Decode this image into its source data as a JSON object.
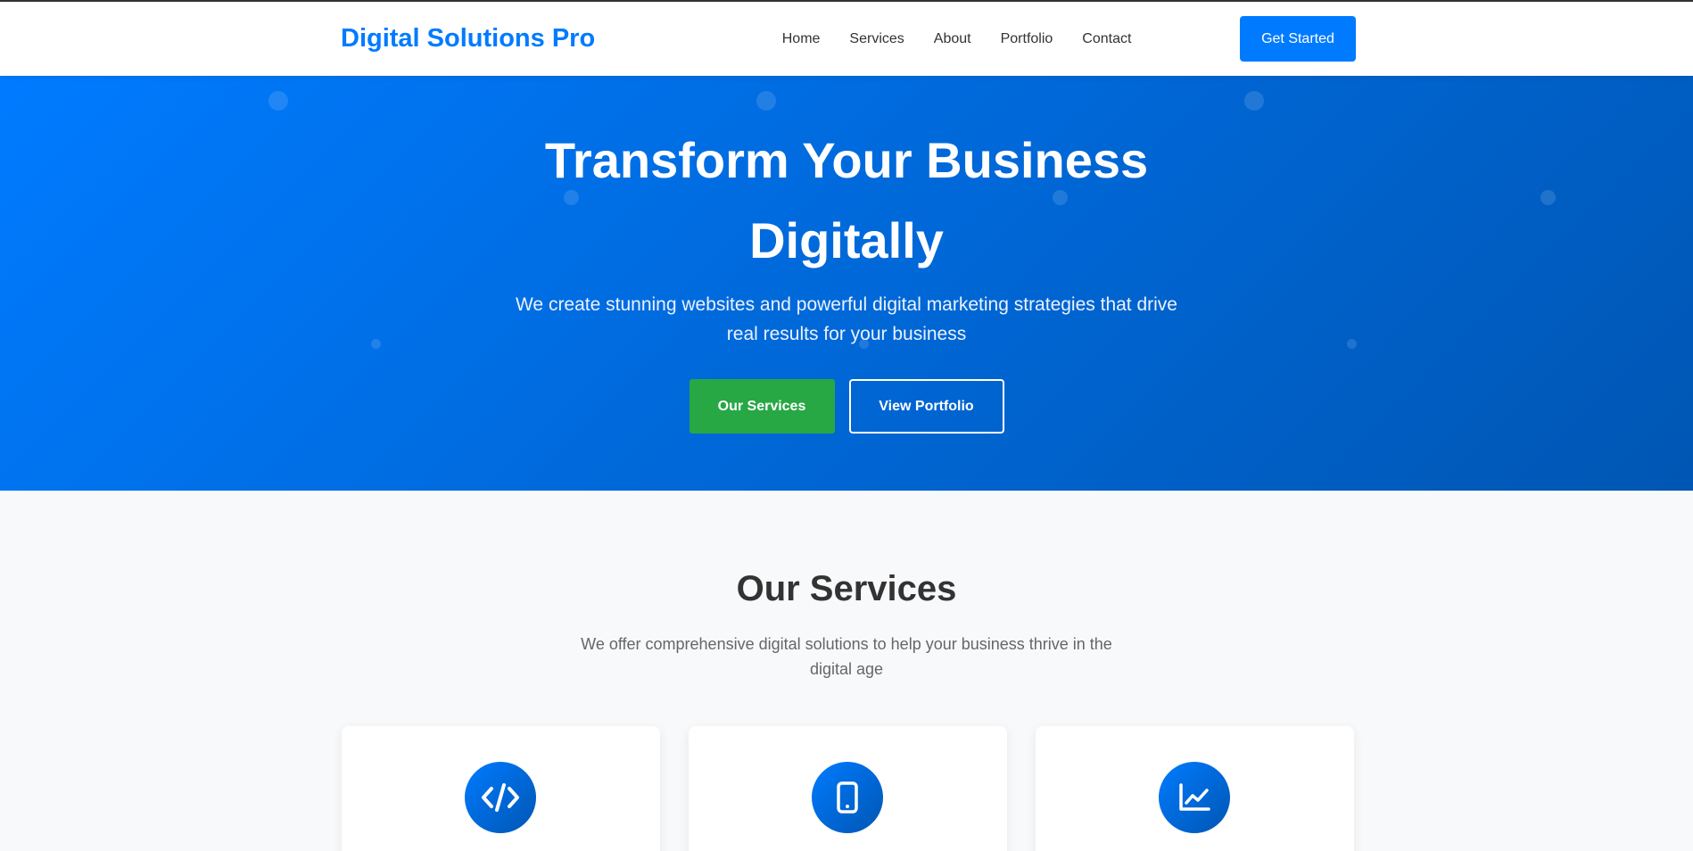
{
  "header": {
    "brand": "Digital Solutions Pro",
    "nav": [
      {
        "label": "Home"
      },
      {
        "label": "Services"
      },
      {
        "label": "About"
      },
      {
        "label": "Portfolio"
      },
      {
        "label": "Contact"
      }
    ],
    "cta_label": "Get Started"
  },
  "hero": {
    "title": "Transform Your Business Digitally",
    "subtitle": "We create stunning websites and powerful digital marketing strategies that drive real results for your business",
    "primary_button": "Our Services",
    "secondary_button": "View Portfolio"
  },
  "services": {
    "title": "Our Services",
    "subtitle": "We offer comprehensive digital solutions to help your business thrive in the digital age",
    "cards": [
      {
        "icon": "code-icon"
      },
      {
        "icon": "mobile-icon"
      },
      {
        "icon": "chart-line-icon"
      }
    ]
  },
  "colors": {
    "primary": "#007bff",
    "primary_dark": "#0056b3",
    "success": "#28a745",
    "text_dark": "#333333",
    "text_muted": "#666666",
    "page_bg": "#f8f9fa"
  }
}
